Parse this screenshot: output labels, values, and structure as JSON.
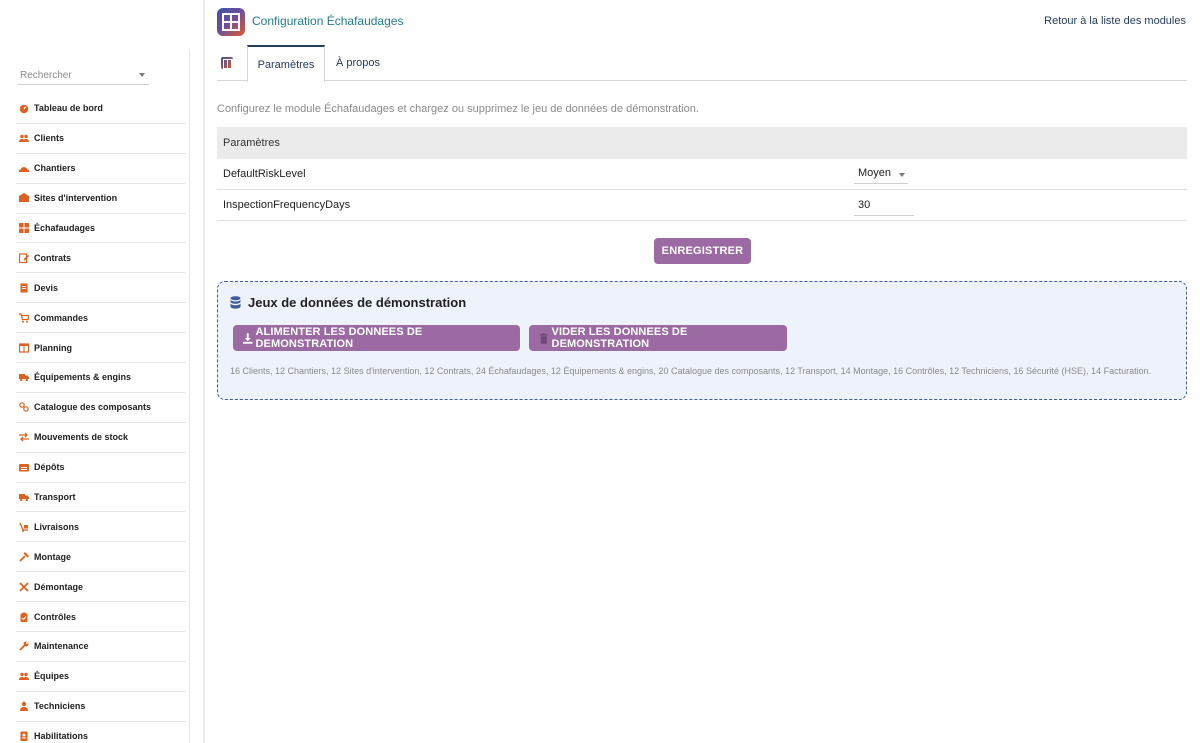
{
  "sidebar": {
    "search_placeholder": "Rechercher",
    "items": [
      {
        "label": "Tableau de bord",
        "icon": "dashboard-icon"
      },
      {
        "label": "Clients",
        "icon": "users-icon"
      },
      {
        "label": "Chantiers",
        "icon": "worksite-icon"
      },
      {
        "label": "Sites d'intervention",
        "icon": "sites-icon"
      },
      {
        "label": "Échafaudages",
        "icon": "grid-icon"
      },
      {
        "label": "Contrats",
        "icon": "contract-icon"
      },
      {
        "label": "Devis",
        "icon": "document-icon"
      },
      {
        "label": "Commandes",
        "icon": "cart-icon"
      },
      {
        "label": "Planning",
        "icon": "calendar-icon"
      },
      {
        "label": "Équipements & engins",
        "icon": "truck-icon"
      },
      {
        "label": "Catalogue des composants",
        "icon": "components-icon"
      },
      {
        "label": "Mouvements de stock",
        "icon": "exchange-icon"
      },
      {
        "label": "Dépôts",
        "icon": "warehouse-icon"
      },
      {
        "label": "Transport",
        "icon": "truck-icon"
      },
      {
        "label": "Livraisons",
        "icon": "delivery-icon"
      },
      {
        "label": "Montage",
        "icon": "hammer-icon"
      },
      {
        "label": "Démontage",
        "icon": "tools-icon"
      },
      {
        "label": "Contrôles",
        "icon": "clipboard-icon"
      },
      {
        "label": "Maintenance",
        "icon": "wrench-icon"
      },
      {
        "label": "Équipes",
        "icon": "users-icon"
      },
      {
        "label": "Techniciens",
        "icon": "user-icon"
      },
      {
        "label": "Habilitations",
        "icon": "badge-icon"
      }
    ]
  },
  "header": {
    "title": "Configuration Échafaudages",
    "back_link": "Retour à la liste des modules"
  },
  "tabs": [
    {
      "label": "Paramètres",
      "active": true
    },
    {
      "label": "À propos",
      "active": false
    }
  ],
  "intro": "Configurez le module Échafaudages et chargez ou supprimez le jeu de données de démonstration.",
  "params": {
    "header": "Paramètres",
    "rows": [
      {
        "name": "DefaultRiskLevel",
        "value": "Moyen",
        "type": "select"
      },
      {
        "name": "InspectionFrequencyDays",
        "value": "30",
        "type": "input"
      }
    ],
    "save_label": "ENREGISTRER"
  },
  "demo": {
    "title": "Jeux de données de démonstration",
    "feed_label": "ALIMENTER LES DONNEES DE DEMONSTRATION",
    "clear_label": "VIDER LES DONNEES DE DEMONSTRATION",
    "summary": "16 Clients, 12 Chantiers, 12 Sites d'intervention, 12 Contrats, 24 Échafaudages, 12 Équipements & engins, 20 Catalogue des composants, 12 Transport, 14 Montage, 16 Contrôles, 12 Techniciens, 16 Sécurité (HSE), 14 Facturation."
  },
  "colors": {
    "accent": "#9b6aa3",
    "title": "#1e7d8a",
    "link": "#263c5c",
    "icon_orange": "#e0601f",
    "demo_bg": "#eef2fb",
    "demo_border": "#3e5c9a"
  }
}
